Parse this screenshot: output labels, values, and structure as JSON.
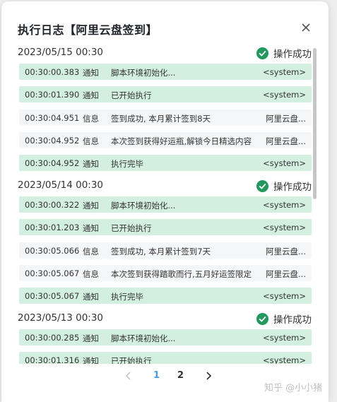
{
  "dialog": {
    "title": "执行日志【阿里云盘签到】",
    "close_icon": "close-icon"
  },
  "groups": [
    {
      "date": "2023/05/15 00:30",
      "status": "操作成功",
      "rows": [
        {
          "time": "00:30:00.383",
          "level": "通知",
          "message": "脚本环境初始化...",
          "source": "<system>",
          "type": "notice"
        },
        {
          "time": "00:30:01.390",
          "level": "通知",
          "message": "已开始执行",
          "source": "<system>",
          "type": "notice"
        },
        {
          "time": "00:30:04.951",
          "level": "信息",
          "message": "签到成功, 本月累计签到8天",
          "source": "阿里云盘...",
          "type": "info"
        },
        {
          "time": "00:30:04.952",
          "level": "信息",
          "message": "本次签到获得好运瓶,解锁今日精选内容",
          "source": "阿里云盘...",
          "type": "info"
        },
        {
          "time": "00:30:04.952",
          "level": "通知",
          "message": "执行完毕",
          "source": "<system>",
          "type": "notice"
        }
      ]
    },
    {
      "date": "2023/05/14 00:30",
      "status": "操作成功",
      "rows": [
        {
          "time": "00:30:00.322",
          "level": "通知",
          "message": "脚本环境初始化...",
          "source": "<system>",
          "type": "notice"
        },
        {
          "time": "00:30:01.203",
          "level": "通知",
          "message": "已开始执行",
          "source": "<system>",
          "type": "notice"
        },
        {
          "time": "00:30:05.066",
          "level": "信息",
          "message": "签到成功, 本月累计签到7天",
          "source": "阿里云盘...",
          "type": "info"
        },
        {
          "time": "00:30:05.067",
          "level": "信息",
          "message": "本次签到获得踏歌而行,五月好运签限定",
          "source": "阿里云盘...",
          "type": "info"
        },
        {
          "time": "00:30:05.067",
          "level": "通知",
          "message": "执行完毕",
          "source": "<system>",
          "type": "notice"
        }
      ]
    },
    {
      "date": "2023/05/13 00:30",
      "status": "操作成功",
      "rows": [
        {
          "time": "00:30:00.285",
          "level": "通知",
          "message": "脚本环境初始化...",
          "source": "<system>",
          "type": "notice"
        },
        {
          "time": "00:30:01.316",
          "level": "通知",
          "message": "已开始执行",
          "source": "<system>",
          "type": "notice"
        }
      ]
    }
  ],
  "pagination": {
    "prev_icon": "chevron-left-icon",
    "pages": [
      "1",
      "2"
    ],
    "current": "1",
    "next_icon": "chevron-right-icon"
  },
  "watermark": "知乎 @小小猪",
  "colors": {
    "notice_row": "#d3efe0",
    "info_row": "#f5f6f7",
    "success": "#1f9a5c",
    "active_page": "#409eff"
  }
}
